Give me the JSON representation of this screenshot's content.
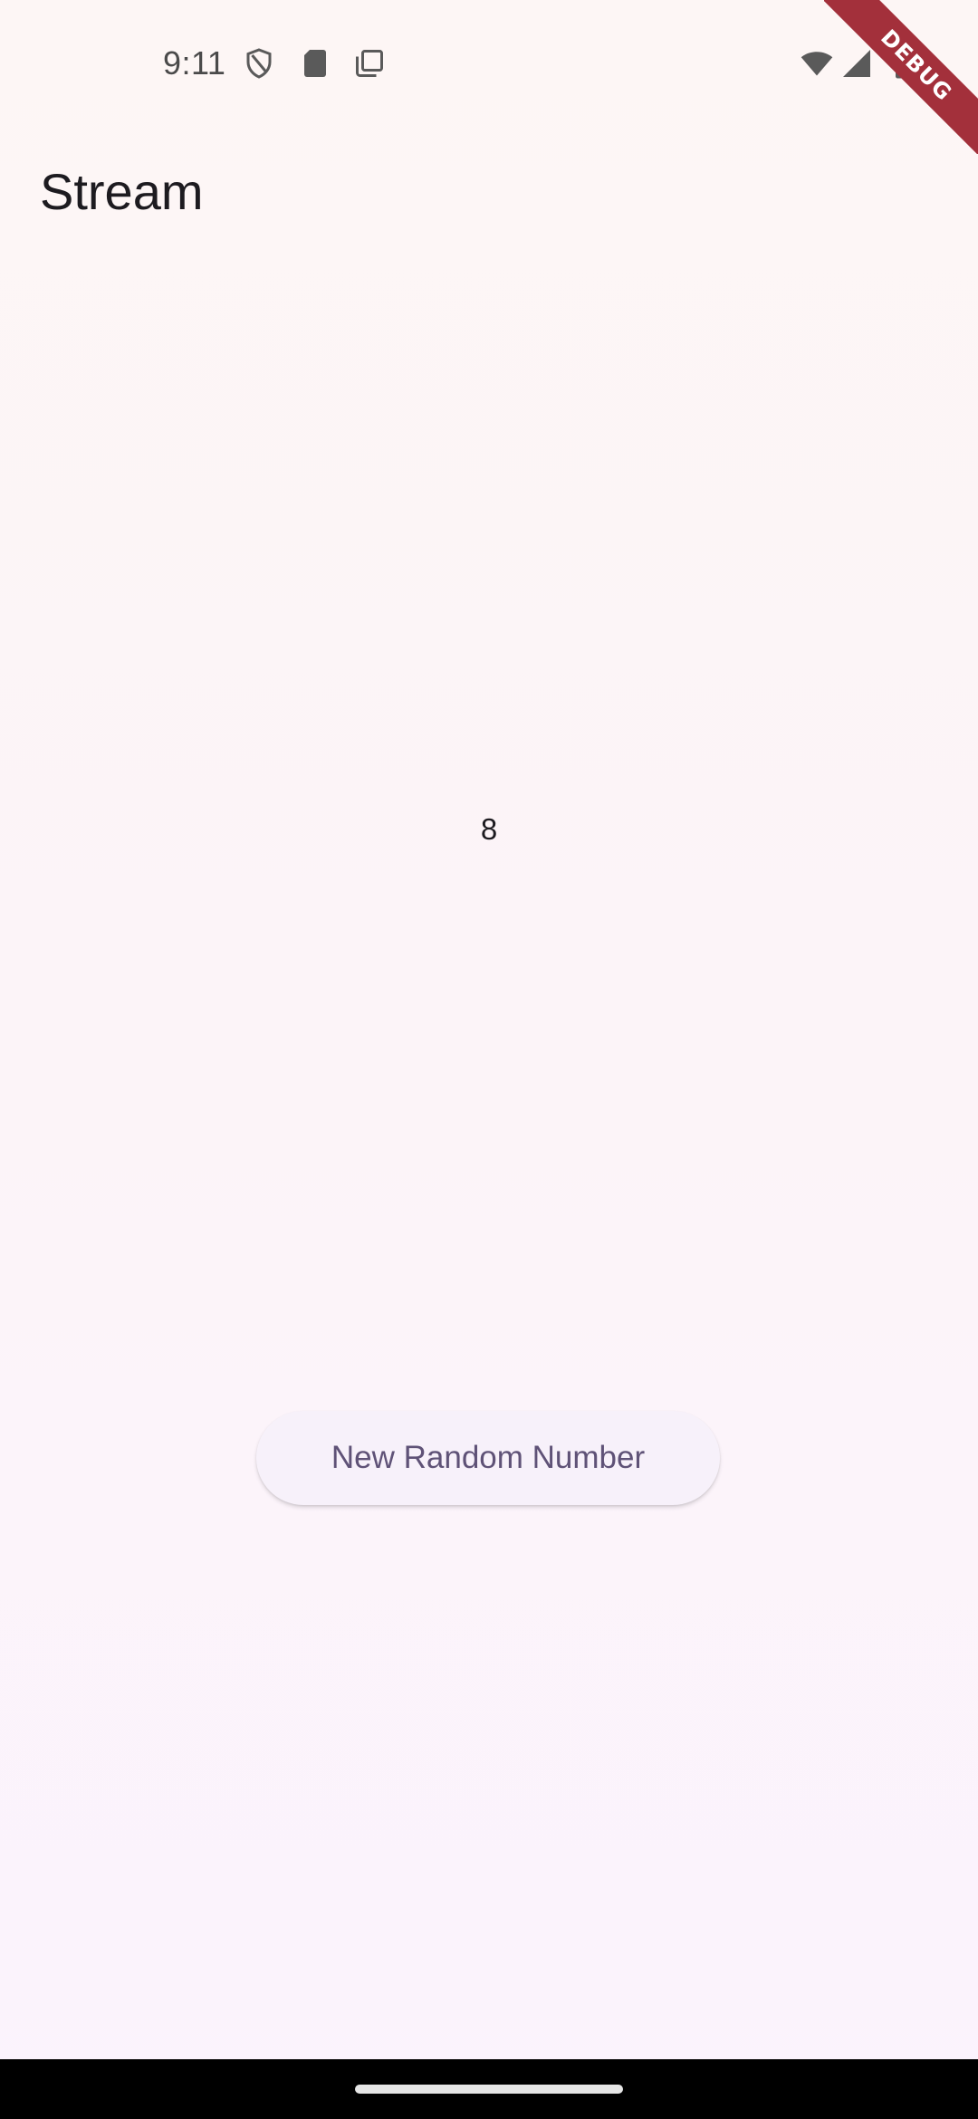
{
  "status_bar": {
    "time": "9:11",
    "left_icons": [
      "shield-icon",
      "sd-card-icon",
      "copy-icon"
    ],
    "right_icons": [
      "wifi-icon",
      "cell-signal-icon",
      "battery-icon"
    ]
  },
  "debug_banner": {
    "label": "DEBUG",
    "color": "#a3303b"
  },
  "app_bar": {
    "title": "Stream"
  },
  "main": {
    "number": "8"
  },
  "actions": {
    "new_random_label": "New Random Number"
  },
  "colors": {
    "background": "#fdf6f5",
    "button_background": "#f7f1fa",
    "button_text": "#5f5277",
    "text": "#1d1b20"
  }
}
